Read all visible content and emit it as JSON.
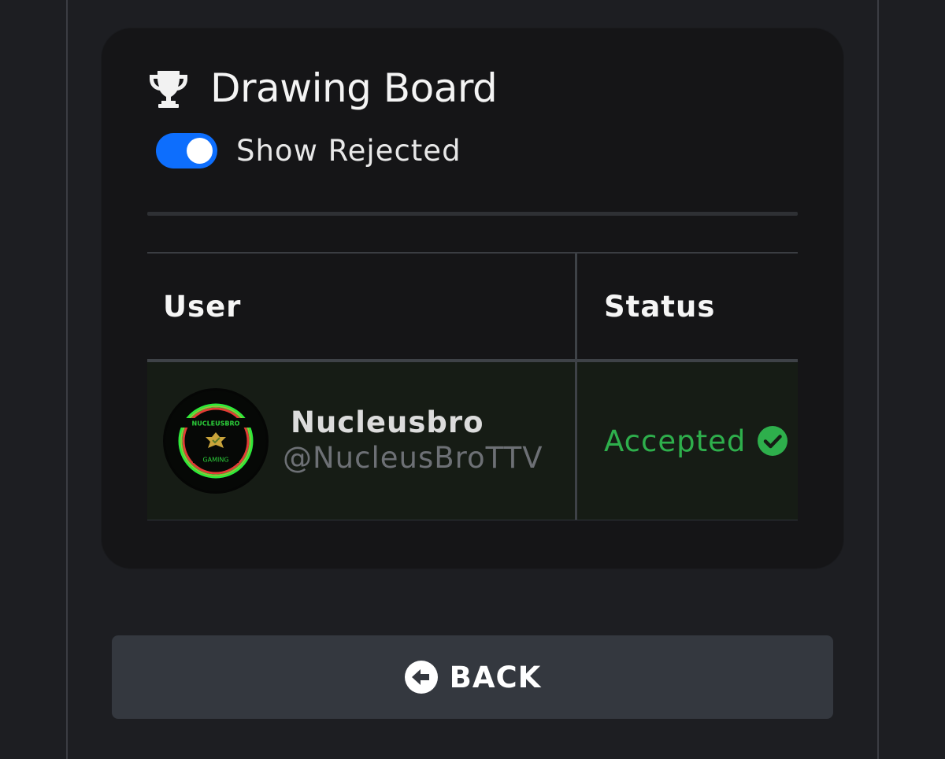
{
  "card": {
    "title": "Drawing Board",
    "title_icon": "trophy-icon",
    "toggle": {
      "label": "Show Rejected",
      "checked": true,
      "color": "#0d6efd"
    }
  },
  "table": {
    "columns": [
      "User",
      "Status"
    ],
    "rows": [
      {
        "name": "Nucleusbro",
        "handle": "@NucleusBroTTV",
        "avatar_text_top": "NUCLEUSBRO",
        "avatar_text_bottom": "GAMING",
        "status": "Accepted",
        "status_icon": "check-circle-icon",
        "status_color": "#2eaf4c"
      }
    ]
  },
  "back_button": {
    "label": "BACK",
    "icon": "arrow-left-circle-icon"
  }
}
